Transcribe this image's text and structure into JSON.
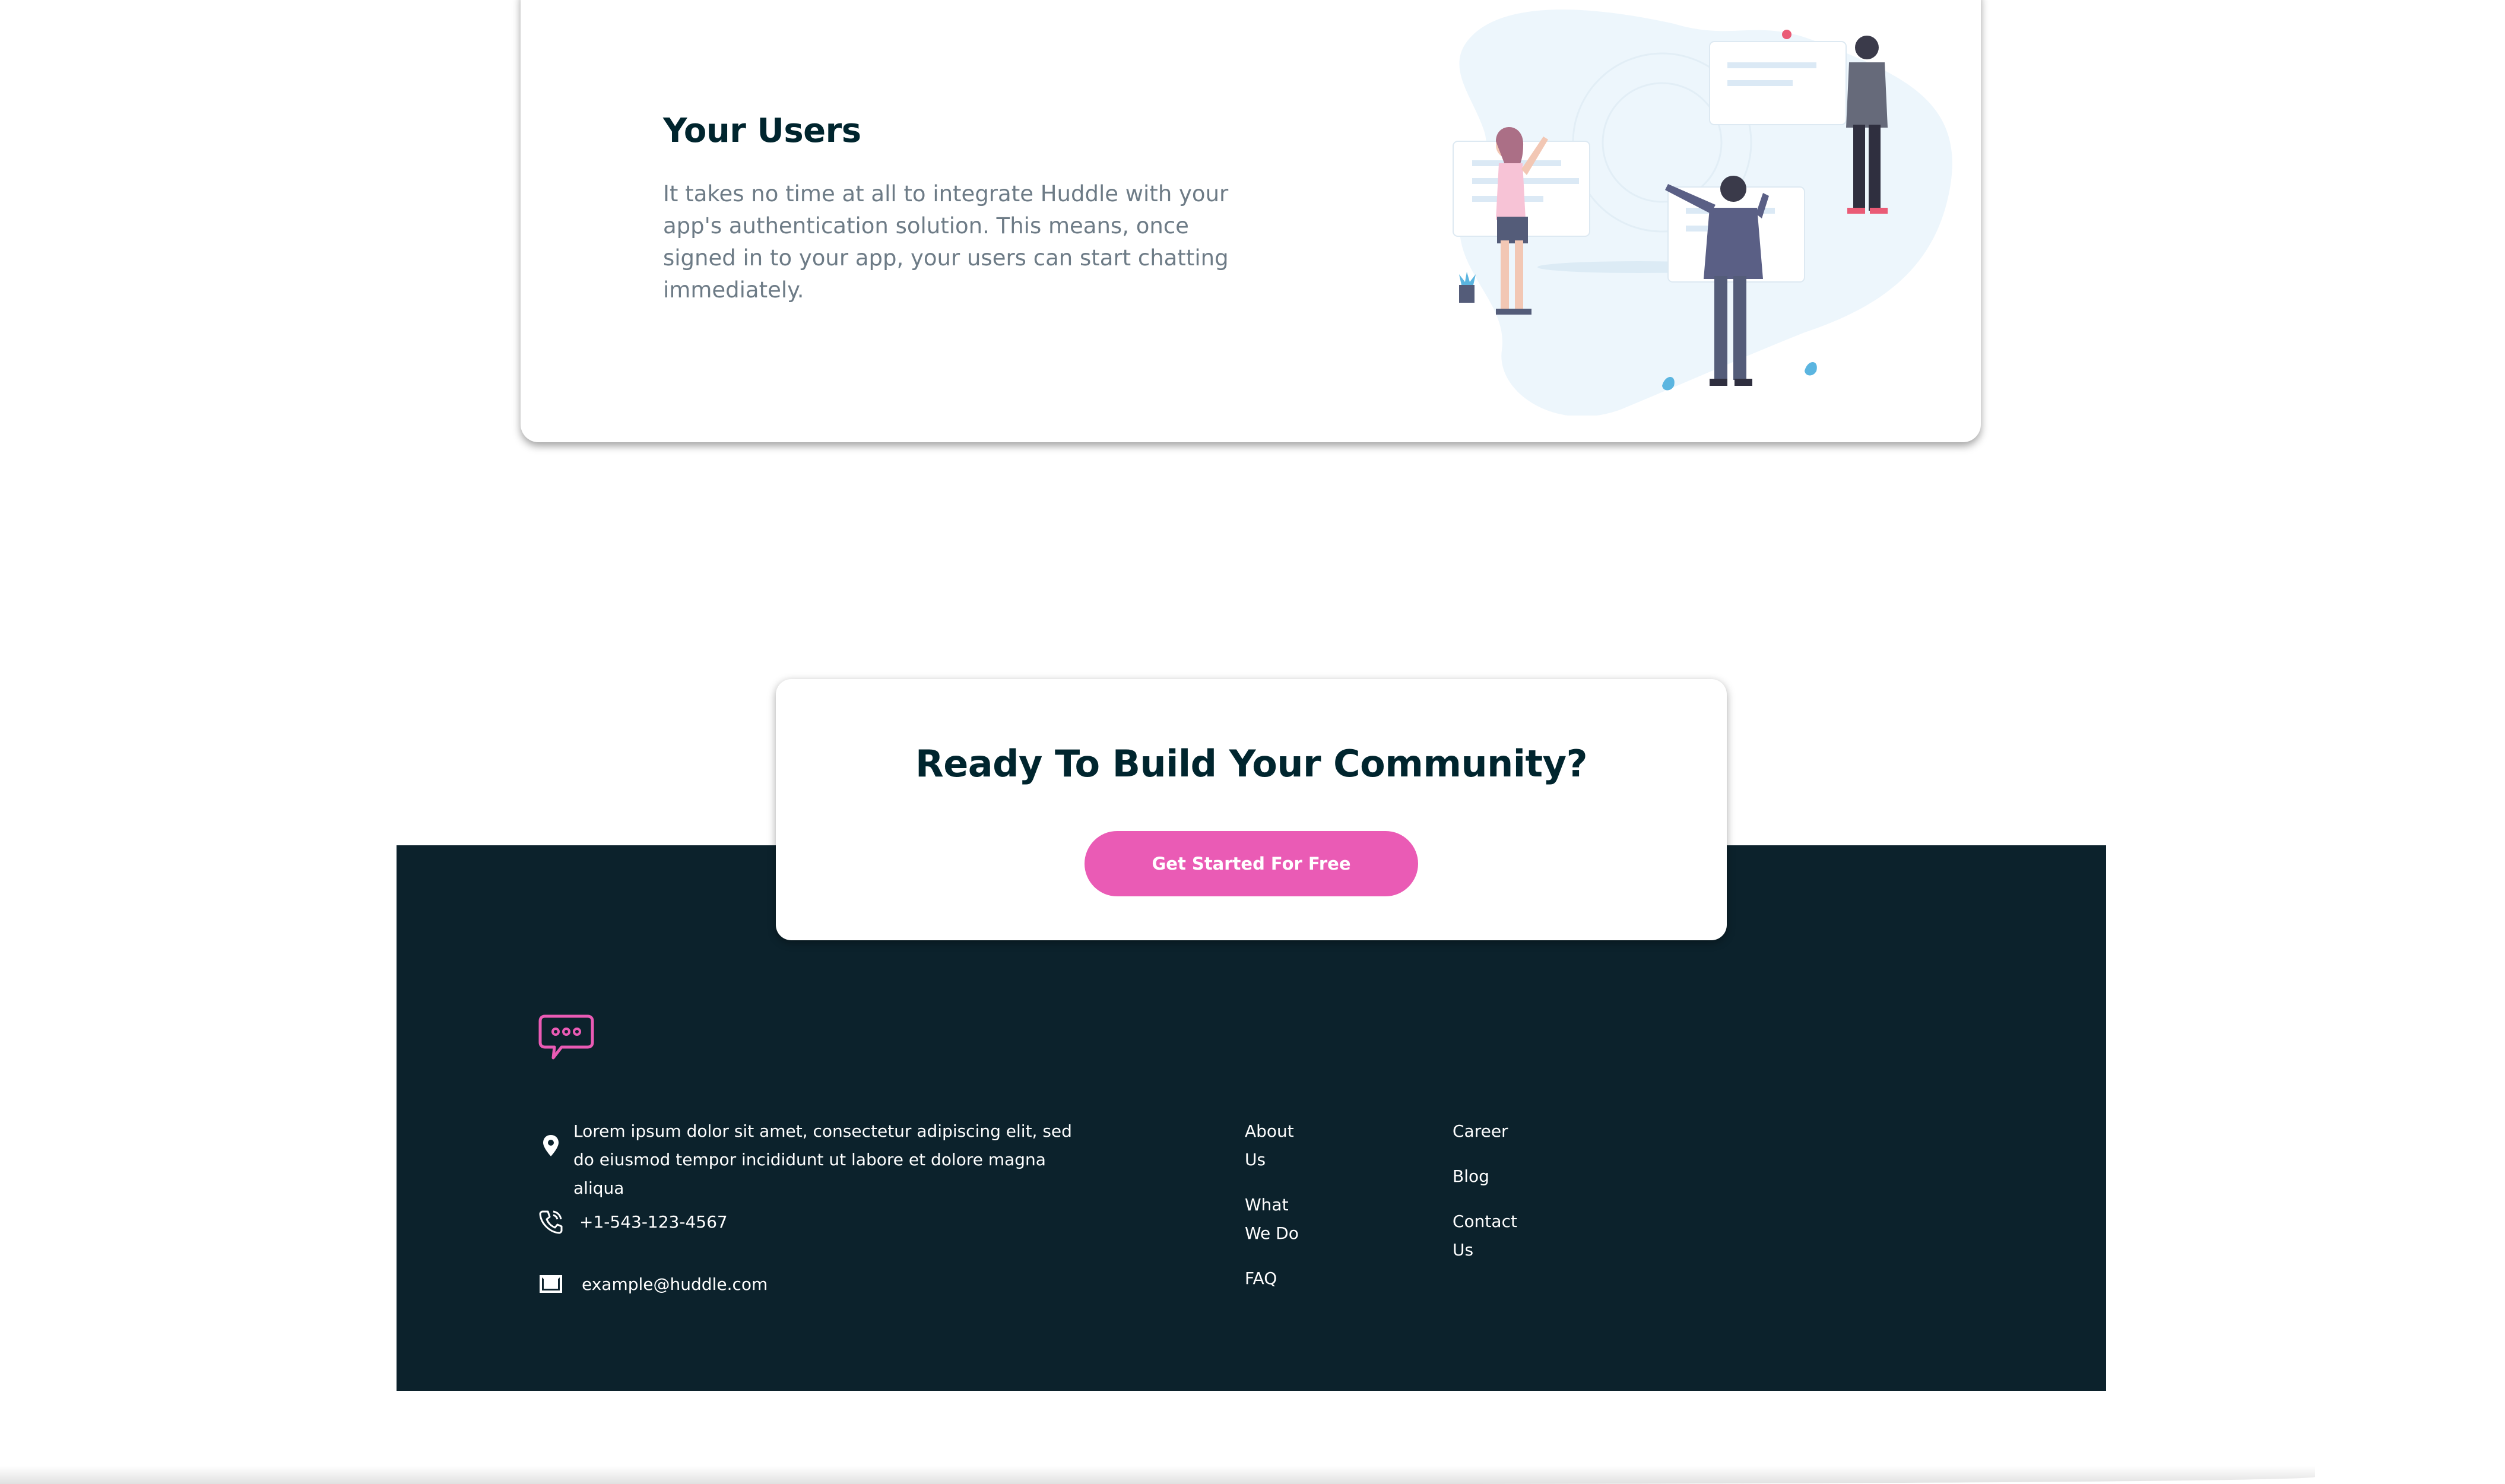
{
  "feature": {
    "title": "Your Users",
    "description": "It takes no time at all to integrate Huddle with your app's authentication solution. This means, once signed in to your app, your users can start chatting immediately."
  },
  "cta": {
    "title": "Ready To Build Your Community?",
    "button_label": "Get Started For Free"
  },
  "footer": {
    "address": "Lorem ipsum dolor sit amet, consectetur adipiscing elit, sed do eiusmod tempor incididunt ut labore et dolore magna aliqua",
    "phone": "+1-543-123-4567",
    "email": "example@huddle.com",
    "links_col1": [
      "About Us",
      "What We Do",
      "FAQ"
    ],
    "links_col2": [
      "Career",
      "Blog",
      "Contact Us"
    ]
  },
  "icons": {
    "logo": "chat-bubble-icon",
    "address": "location-pin-icon",
    "phone": "phone-icon",
    "email": "mail-icon"
  },
  "colors": {
    "dark_navy": "#0c222c",
    "pink_accent": "#ea5bb5",
    "heading": "#00252e",
    "body_text": "#6d7b86"
  }
}
